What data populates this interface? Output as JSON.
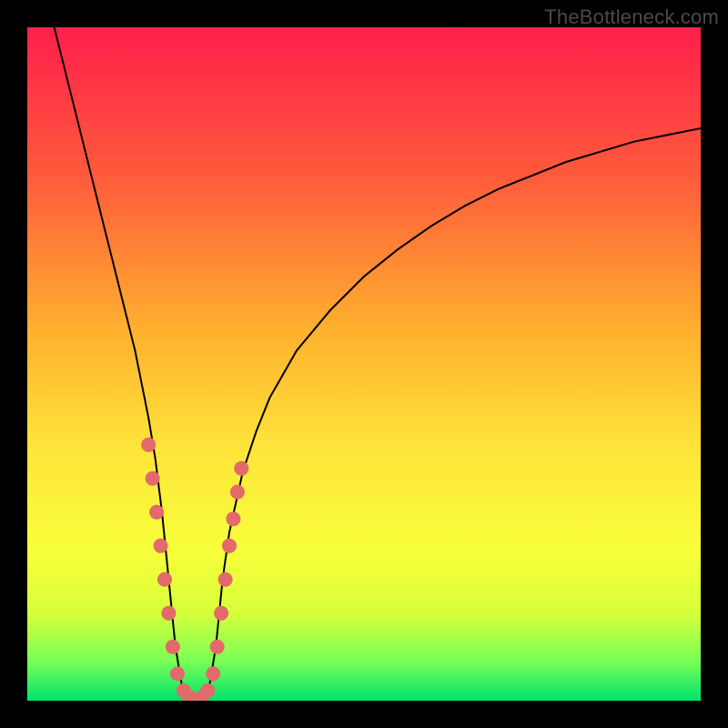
{
  "watermark": "TheBottleneck.com",
  "colors": {
    "frame": "#000000",
    "curve": "#000000",
    "marker": "#e26a6a",
    "gradient_css": "linear-gradient(to bottom, #ff1f4b 0%, #ff5a3c 22%, #ffb02e 45%, #ffe33a 62%, #f7ff3a 78%, #d6ff3a 87%, #7bff55 94%, #00e36b 100%)"
  },
  "chart_data": {
    "type": "line",
    "title": "",
    "xlabel": "",
    "ylabel": "",
    "xlim": [
      0,
      100
    ],
    "ylim": [
      0,
      100
    ],
    "grid": false,
    "x": [
      4,
      6,
      8,
      10,
      12,
      14,
      16,
      18,
      19,
      20,
      21,
      22,
      23,
      24,
      25,
      26,
      27,
      28,
      29,
      30,
      32,
      34,
      36,
      40,
      45,
      50,
      55,
      60,
      65,
      70,
      75,
      80,
      85,
      90,
      95,
      100
    ],
    "y": [
      100,
      92,
      84,
      76,
      68,
      60,
      52,
      42,
      36,
      28,
      18,
      8,
      2,
      0,
      0,
      0,
      2,
      8,
      18,
      25,
      34,
      40,
      45,
      52,
      58,
      63,
      67,
      70.5,
      73.5,
      76,
      78,
      80,
      81.5,
      83,
      84,
      85
    ],
    "markers": {
      "note": "dotted salmon markers along lower portion of the V curve",
      "x": [
        18.0,
        18.6,
        19.2,
        19.8,
        20.4,
        21.0,
        21.6,
        22.3,
        23.2,
        24.1,
        25.0,
        25.9,
        26.8,
        27.6,
        28.2,
        28.8,
        29.4,
        30.0,
        30.6,
        31.2,
        31.8
      ],
      "y": [
        38.0,
        33.0,
        28.0,
        23.0,
        18.0,
        13.0,
        8.0,
        4.0,
        1.5,
        0.5,
        0.0,
        0.5,
        1.5,
        4.0,
        8.0,
        13.0,
        18.0,
        23.0,
        27.0,
        31.0,
        34.5
      ],
      "radius": 8
    }
  }
}
